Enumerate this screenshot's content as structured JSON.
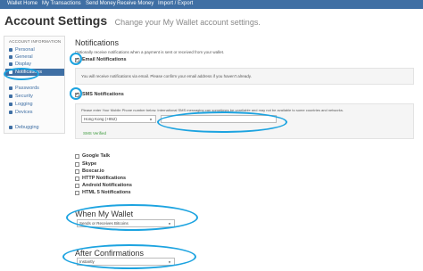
{
  "topnav": {
    "items": [
      "Wallet Home",
      "My Transactions",
      "Send Money",
      "Receive Money",
      "Import / Export"
    ],
    "color": "#3f6fa4"
  },
  "header": {
    "title": "Account Settings",
    "subtitle": "Change your My Wallet account settings."
  },
  "sidebar": {
    "heading": "ACCOUNT INFORMATION",
    "items": [
      {
        "label": "Personal",
        "icon": "user-icon",
        "active": false
      },
      {
        "label": "General",
        "icon": "wrench-icon",
        "active": false
      },
      {
        "label": "Display",
        "icon": "display-icon",
        "active": false
      },
      {
        "label": "Notifications",
        "icon": "bell-icon",
        "active": true
      },
      {
        "label": "Passwords",
        "icon": "key-icon",
        "active": false
      },
      {
        "label": "Security",
        "icon": "lock-icon",
        "active": false
      },
      {
        "label": "Logging",
        "icon": "list-icon",
        "active": false
      },
      {
        "label": "Devices",
        "icon": "device-icon",
        "active": false
      },
      {
        "label": "Debugging",
        "icon": "bug-icon",
        "active": false
      }
    ]
  },
  "notifications": {
    "title": "Notifications",
    "description": "Optionally receive notifications when a payment is sent or received from your wallet.",
    "email": {
      "label": "Email Notifications",
      "checked": true,
      "note": "You will receive notifications via email. Please confirm your email address if you haven't already."
    },
    "sms": {
      "label": "SMS Notifications",
      "checked": true,
      "note": "Please enter Your Mobile Phone number below. International SMS messaging can sometimes be unreliable and may not be available to some countries and networks.",
      "country": "Hong Kong (+852)",
      "phone_value": "",
      "status": "SMS Verified",
      "status_color": "#3c9a3c"
    },
    "others": [
      {
        "label": "Google Talk",
        "checked": false
      },
      {
        "label": "Skype",
        "checked": false
      },
      {
        "label": "Boxcar.io",
        "checked": false
      },
      {
        "label": "HTTP Notifications",
        "checked": false
      },
      {
        "label": "Android Notifications",
        "checked": false
      },
      {
        "label": "HTML 5 Notifications",
        "checked": false
      }
    ]
  },
  "when_wallet": {
    "title": "When My Wallet",
    "selected": "Sends or Receives Bitcoins"
  },
  "after_confirmations": {
    "title": "After Confirmations",
    "selected": "Instantly"
  },
  "annotation_color": "#1ca3e0"
}
